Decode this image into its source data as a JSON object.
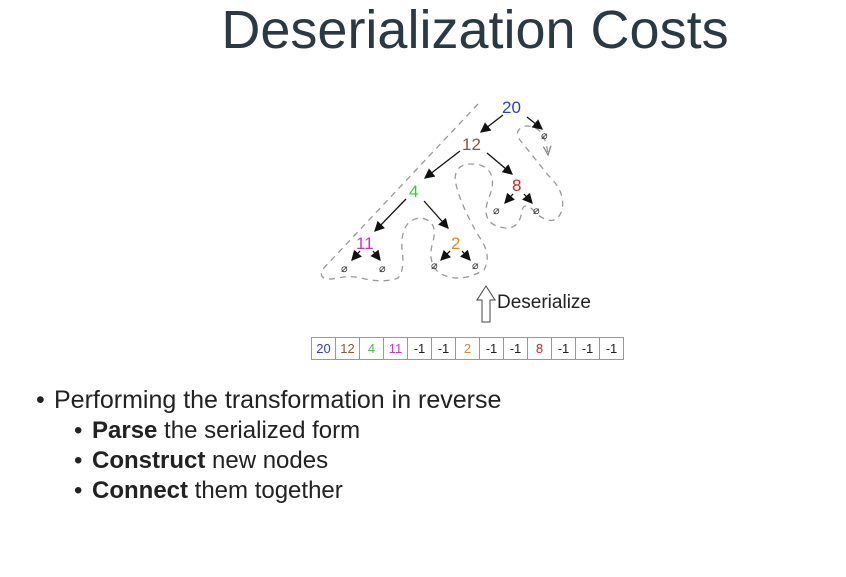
{
  "slide": {
    "title": "Deserialization Costs"
  },
  "tree": {
    "nodes": [
      {
        "id": "n20",
        "value": "20",
        "color": "#2a3ed9"
      },
      {
        "id": "n12",
        "value": "12",
        "color": "#8b5a2b"
      },
      {
        "id": "n4",
        "value": "4",
        "color": "#33cc33"
      },
      {
        "id": "n8",
        "value": "8",
        "color": "#e02020"
      },
      {
        "id": "n11",
        "value": "11",
        "color": "#cc33cc"
      },
      {
        "id": "n2",
        "value": "2",
        "color": "#e08a1e"
      }
    ],
    "null_symbol": "⌀"
  },
  "deserialize": {
    "label": "Deserialize"
  },
  "serialized": {
    "cells": [
      {
        "text": "20",
        "color": "#2a3ed9"
      },
      {
        "text": "12",
        "color": "#8b5a2b"
      },
      {
        "text": "4",
        "color": "#33cc33"
      },
      {
        "text": "11",
        "color": "#cc33cc"
      },
      {
        "text": "-1",
        "color": "#222222"
      },
      {
        "text": "-1",
        "color": "#222222"
      },
      {
        "text": "2",
        "color": "#e08a1e"
      },
      {
        "text": "-1",
        "color": "#222222"
      },
      {
        "text": "-1",
        "color": "#222222"
      },
      {
        "text": "8",
        "color": "#e02020"
      },
      {
        "text": "-1",
        "color": "#222222"
      },
      {
        "text": "-1",
        "color": "#222222"
      },
      {
        "text": "-1",
        "color": "#222222"
      }
    ]
  },
  "bullets": {
    "main": "Performing the transformation in reverse",
    "sub": [
      {
        "bold": "Parse",
        "rest": " the serialized form"
      },
      {
        "bold": "Construct",
        "rest": " new nodes"
      },
      {
        "bold": "Connect",
        "rest": " them together"
      }
    ]
  }
}
